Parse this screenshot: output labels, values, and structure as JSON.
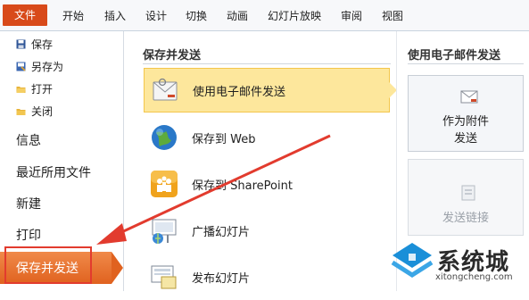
{
  "ribbon": {
    "file_tab": "文件",
    "tabs": [
      "开始",
      "插入",
      "设计",
      "切换",
      "动画",
      "幻灯片放映",
      "审阅",
      "视图"
    ]
  },
  "leftnav": {
    "commands": [
      {
        "label": "保存",
        "icon": "save-icon"
      },
      {
        "label": "另存为",
        "icon": "save-as-icon"
      },
      {
        "label": "打开",
        "icon": "open-folder-icon"
      },
      {
        "label": "关闭",
        "icon": "close-folder-icon"
      }
    ],
    "items": [
      "信息",
      "最近所用文件",
      "新建",
      "打印"
    ],
    "selected": "保存并发送"
  },
  "middle": {
    "title": "保存并发送",
    "options": [
      {
        "label": "使用电子邮件发送",
        "icon": "email-icon",
        "active": true
      },
      {
        "label": "保存到 Web",
        "icon": "globe-icon",
        "active": false
      },
      {
        "label": "保存到 SharePoint",
        "icon": "sharepoint-icon",
        "active": false
      },
      {
        "label": "广播幻灯片",
        "icon": "broadcast-icon",
        "active": false
      },
      {
        "label": "发布幻灯片",
        "icon": "publish-slides-icon",
        "active": false
      }
    ]
  },
  "right": {
    "title": "使用电子邮件发送",
    "cards": [
      {
        "line1": "作为附件",
        "line2": "发送",
        "enabled": true
      },
      {
        "line1": "发送链接",
        "line2": "",
        "enabled": false
      }
    ]
  },
  "watermark": {
    "text": "系统城",
    "url": "xitongcheng.com"
  },
  "colors": {
    "accent_orange": "#e0621f",
    "highlight_yellow": "#fde79c",
    "annotation_red": "#e23b2e"
  }
}
